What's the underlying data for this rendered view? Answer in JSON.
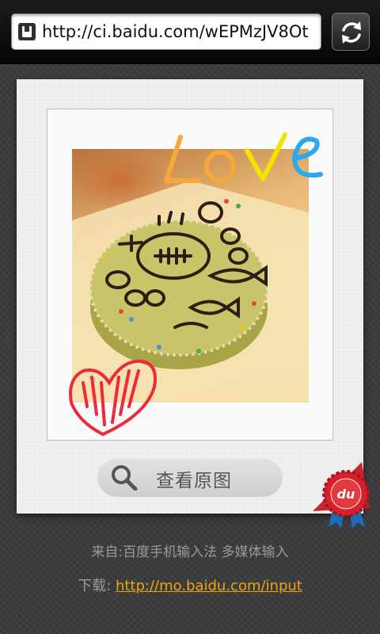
{
  "browser": {
    "url": "http://ci.baidu.com/wEPMzJV8Ot",
    "page_icon": "page-icon",
    "reload_icon": "reload-icon"
  },
  "card": {
    "photo_caption_doodle": "Love",
    "view_original_label": "查看原图",
    "search_icon": "search-icon",
    "badge_text": "du"
  },
  "footer": {
    "source_text": "来自:百度手机输入法 多媒体输入",
    "download_label": "下载: ",
    "download_link": "http://mo.baidu.com/input"
  },
  "colors": {
    "link": "#f0a30a",
    "love_orange": "#f6a93a",
    "love_yellow": "#f2e300",
    "love_blue": "#2aa8f0",
    "heart_red": "#f0283c",
    "badge_red": "#d8202a",
    "ribbon_blue": "#1a6fb8"
  }
}
